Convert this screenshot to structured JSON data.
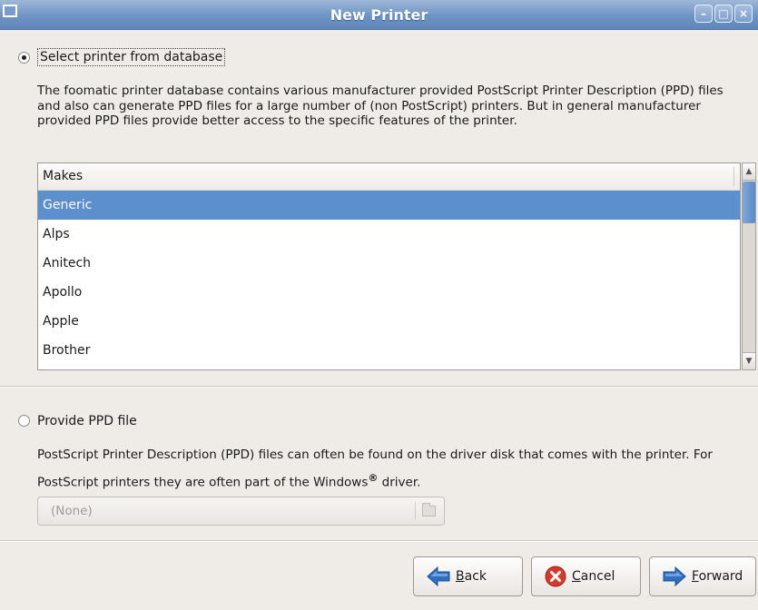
{
  "window": {
    "title": "New Printer",
    "menu_icon": "window-menu-icon",
    "controls": [
      "minimize-icon",
      "maximize-icon",
      "close-icon"
    ]
  },
  "option_database": {
    "label": "Select printer from database",
    "selected": true,
    "description": "The foomatic printer database contains various manufacturer provided PostScript Printer Description (PPD) files and also can generate PPD files for a large number of (non PostScript) printers. But in general manufacturer provided PPD files provide better access to the specific features of the printer."
  },
  "makes_list": {
    "header": "Makes",
    "items": [
      "Generic",
      "Alps",
      "Anitech",
      "Apollo",
      "Apple",
      "Brother"
    ],
    "selected_index": 0
  },
  "option_ppd": {
    "label": "Provide PPD file",
    "selected": false,
    "description_part1": "PostScript Printer Description (PPD) files can often be found on the driver disk that comes with the printer. For PostScript printers they are often part of the Windows",
    "registered_mark": "®",
    "description_part2": " driver."
  },
  "file_chooser": {
    "value": "(None)",
    "icon": "folder-icon"
  },
  "buttons": {
    "back": {
      "mnemonic": "B",
      "rest": "ack",
      "icon": "back-arrow-icon"
    },
    "cancel": {
      "mnemonic": "C",
      "rest": "ancel",
      "icon": "cancel-icon"
    },
    "forward": {
      "mnemonic": "F",
      "rest": "orward",
      "icon": "forward-arrow-icon"
    }
  },
  "colors": {
    "selection": "#5b8fcd",
    "titlebar": "#6e93c4",
    "arrow_blue": "#2f6fc1",
    "cancel_red": "#d33a2c"
  }
}
